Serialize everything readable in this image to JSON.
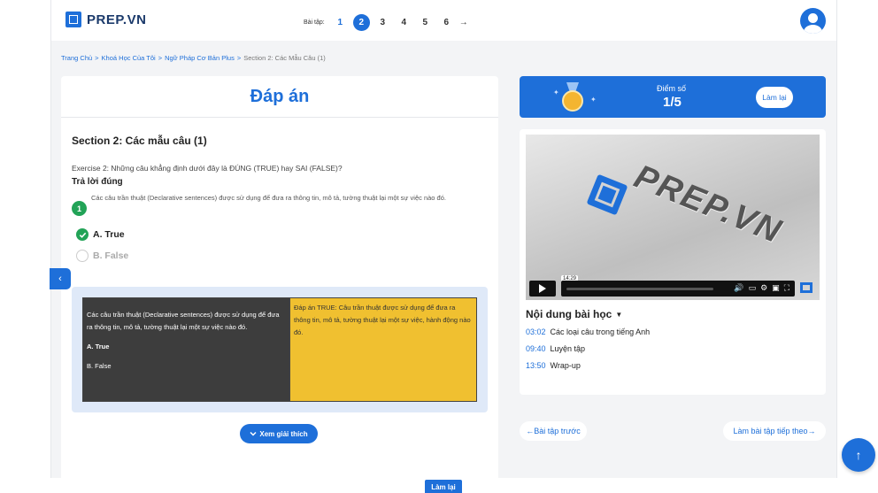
{
  "brand": {
    "logo_text": "PREP.VN"
  },
  "pager": {
    "label": "Bài tập:",
    "pages": [
      "1",
      "2",
      "3",
      "4",
      "5",
      "6"
    ],
    "active_index": 1,
    "next_arrow": "→"
  },
  "breadcrumb": {
    "items": [
      "Trang Chủ",
      "Khoá Học Của Tôi",
      "Ngữ Pháp Cơ Bản Plus"
    ],
    "separator": ">",
    "current": "Section 2: Các Mẫu Câu (1)"
  },
  "answer_panel": {
    "title": "Đáp án",
    "section_title": "Section 2: Các mẫu câu (1)",
    "exercise_text": "Exercise 2: Những câu khẳng định dưới đây là ĐÚNG (TRUE) hay SAI (FALSE)?",
    "answer_status": "Trả lời đúng",
    "question_number": "1",
    "question_text": "Các câu trần thuật (Declarative sentences) được sử dụng để đưa ra thông tin, mô tả, tường thuật lại một sự việc nào đó.",
    "options": [
      {
        "label": "A. True",
        "selected": true
      },
      {
        "label": "B. False",
        "selected": false
      }
    ],
    "explanation": {
      "question": "Các câu trần thuật (Declarative sentences) được sử dụng để đưa ra thông tin, mô tả, tường thuật lại một sự việc nào đó.",
      "option_a": "A. True",
      "option_b": "B. False",
      "answer": "Đáp án TRUE: Câu trần thuật được sử dụng để đưa ra thông tin, mô tả, tường thuật lại một sự việc, hành động nào đó."
    },
    "explain_button": "Xem giải thích"
  },
  "score": {
    "label": "Điểm số",
    "value": "1/5",
    "retry_label": "Làm lại"
  },
  "video": {
    "watermark": "PREP.VN",
    "time_tooltip": "14:29"
  },
  "lesson": {
    "title": "Nội dung bài học",
    "chapters": [
      {
        "time": "03:02",
        "name": "Các loại câu trong tiếng Anh"
      },
      {
        "time": "09:40",
        "name": "Luyện tập"
      },
      {
        "time": "13:50",
        "name": "Wrap-up"
      }
    ]
  },
  "nav": {
    "prev": "←Bài tập trước",
    "next": "Làm bài tập tiếp theo→"
  },
  "bottom": {
    "retry_label": "Làm lại"
  },
  "colors": {
    "accent": "#1e6fd9",
    "success": "#22a357",
    "highlight": "#f0c030",
    "dark_cell": "#3d3d3d"
  }
}
